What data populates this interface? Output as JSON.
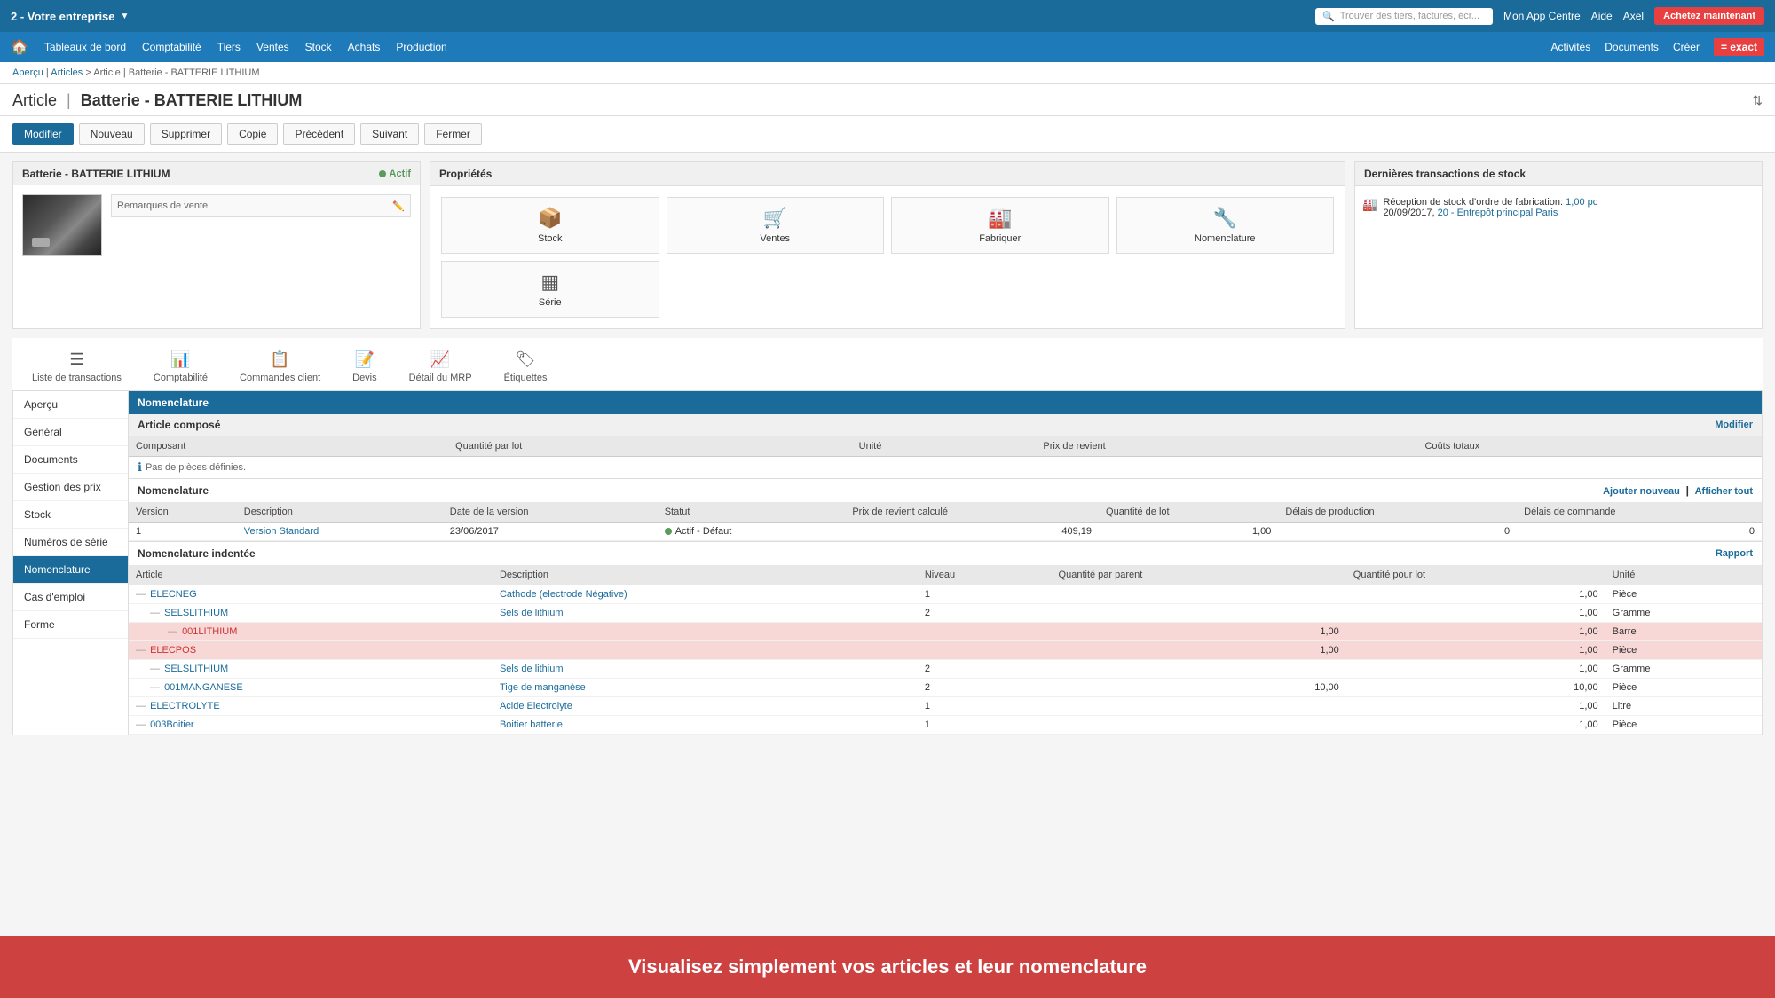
{
  "app": {
    "company": "2 - Votre entreprise",
    "title": "Article | Batterie - BATTERIE LITHIUM",
    "page_title": "Article",
    "article_name": "Batterie - BATTERIE LITHIUM"
  },
  "topbar": {
    "search_placeholder": "Trouver des tiers, factures, écr...",
    "mon_app_centre": "Mon App Centre",
    "aide": "Aide",
    "user": "Axel",
    "achetez": "Achetez maintenant"
  },
  "navbar": {
    "items": [
      {
        "label": "Tableaux de bord"
      },
      {
        "label": "Comptabilité"
      },
      {
        "label": "Tiers"
      },
      {
        "label": "Ventes"
      },
      {
        "label": "Stock"
      },
      {
        "label": "Achats"
      },
      {
        "label": "Production"
      }
    ],
    "right": [
      {
        "label": "Activités"
      },
      {
        "label": "Documents"
      },
      {
        "label": "Créer"
      }
    ]
  },
  "breadcrumb": {
    "items": [
      "Aperçu",
      "Articles",
      "Article | Batterie - BATTERIE LITHIUM"
    ]
  },
  "action_buttons": [
    {
      "label": "Modifier",
      "type": "primary"
    },
    {
      "label": "Nouveau",
      "type": "default"
    },
    {
      "label": "Supprimer",
      "type": "default"
    },
    {
      "label": "Copie",
      "type": "default"
    },
    {
      "label": "Précédent",
      "type": "default"
    },
    {
      "label": "Suivant",
      "type": "default"
    },
    {
      "label": "Fermer",
      "type": "default"
    }
  ],
  "article": {
    "name": "Batterie - BATTERIE LITHIUM",
    "status": "Actif",
    "remarks_label": "Remarques de vente"
  },
  "proprietes": {
    "title": "Propriétés",
    "items": [
      {
        "label": "Stock",
        "icon": "📦"
      },
      {
        "label": "Ventes",
        "icon": "🛒"
      },
      {
        "label": "Fabriquer",
        "icon": "🏭"
      },
      {
        "label": "Nomenclature",
        "icon": "🔧"
      },
      {
        "label": "Série",
        "icon": "▦"
      }
    ]
  },
  "transactions": {
    "title": "Dernières transactions de stock",
    "items": [
      {
        "text": "Réception de stock d'ordre de fabrication:",
        "value": "1,00 pc",
        "date": "20/09/2017,",
        "link": "20 - Entrepôt principal Paris"
      }
    ]
  },
  "tabs": [
    {
      "label": "Liste de transactions",
      "icon": "☰"
    },
    {
      "label": "Comptabilité",
      "icon": "📊"
    },
    {
      "label": "Commandes client",
      "icon": "📋"
    },
    {
      "label": "Devis",
      "icon": "📝"
    },
    {
      "label": "Détail du MRP",
      "icon": "📈"
    },
    {
      "label": "Étiquettes",
      "icon": "🏷"
    }
  ],
  "left_menu": {
    "items": [
      {
        "label": "Aperçu",
        "active": false
      },
      {
        "label": "Général",
        "active": false
      },
      {
        "label": "Documents",
        "active": false
      },
      {
        "label": "Gestion des prix",
        "active": false
      },
      {
        "label": "Stock",
        "active": false
      },
      {
        "label": "Numéros de série",
        "active": false
      },
      {
        "label": "Nomenclature",
        "active": true
      },
      {
        "label": "Cas d'emploi",
        "active": false
      },
      {
        "label": "Forme",
        "active": false
      }
    ]
  },
  "nomenclature": {
    "section_title": "Nomenclature",
    "article_compose": {
      "title": "Article composé",
      "modifier_link": "Modifier",
      "columns": [
        "Composant",
        "Quantité par lot",
        "Unité",
        "Prix de revient",
        "Coûts totaux"
      ],
      "no_pieces": "Pas de pièces définies."
    },
    "table": {
      "title": "Nomenclature",
      "ajouter_link": "Ajouter nouveau",
      "afficher_link": "Afficher tout",
      "columns": [
        "Version",
        "Description",
        "Date de la version",
        "Statut",
        "Prix de revient calculé",
        "Quantité de lot",
        "Délais de production",
        "Délais de commande"
      ],
      "rows": [
        {
          "version": "1",
          "description": "Version Standard",
          "date": "23/06/2017",
          "statut": "Actif - Défaut",
          "prix": "409,19",
          "qte_lot": "1,00",
          "delais_prod": "0",
          "delais_cmd": "0"
        }
      ]
    },
    "indented": {
      "title": "Nomenclature indentée",
      "rapport_link": "Rapport",
      "columns": [
        "Article",
        "Description",
        "Niveau",
        "Quantité par parent",
        "Quantité pour lot",
        "Unité"
      ],
      "rows": [
        {
          "code": "ELECNEG",
          "link": true,
          "description": "Cathode (electrode Négative)",
          "desc_link": true,
          "level": "1",
          "qte_parent": "",
          "qte_lot": "1,00",
          "unit": "Pièce",
          "indent": 0
        },
        {
          "code": "SELSLITHIUM",
          "link": true,
          "description": "Sels de lithium",
          "desc_link": true,
          "level": "2",
          "qte_parent": "",
          "qte_lot": "1,00",
          "unit": "Gramme",
          "indent": 1
        },
        {
          "code": "001LITHIUM",
          "link": true,
          "description": "",
          "desc_link": false,
          "level": "",
          "qte_parent": "1,00",
          "qte_lot": "1,00",
          "unit": "Barre",
          "indent": 2,
          "highlight": true
        },
        {
          "code": "ELECPOS",
          "link": true,
          "description": "",
          "desc_link": false,
          "level": "",
          "qte_parent": "1,00",
          "qte_lot": "1,00",
          "unit": "Pièce",
          "indent": 0,
          "highlight": true
        },
        {
          "code": "SELSLITHIUM",
          "link": true,
          "description": "Sels de lithium",
          "desc_link": true,
          "level": "2",
          "qte_parent": "",
          "qte_lot": "1,00",
          "unit": "Gramme",
          "indent": 1
        },
        {
          "code": "001MANGANESE",
          "link": true,
          "description": "Tige de manganèse",
          "desc_link": true,
          "level": "2",
          "qte_parent": "10,00",
          "qte_lot": "10,00",
          "unit": "Pièce",
          "indent": 1
        },
        {
          "code": "ELECTROLYTE",
          "link": true,
          "description": "Acide Electrolyte",
          "desc_link": true,
          "level": "1",
          "qte_parent": "",
          "qte_lot": "1,00",
          "unit": "Litre",
          "indent": 0
        },
        {
          "code": "003Boitier",
          "link": true,
          "description": "Boitier batterie",
          "desc_link": true,
          "level": "1",
          "qte_parent": "",
          "qte_lot": "1,00",
          "unit": "Pièce",
          "indent": 0
        }
      ]
    }
  },
  "overlay": {
    "text": "Visualisez simplement vos articles et leur nomenclature"
  },
  "colors": {
    "primary": "#1a6b9a",
    "accent": "#e84040",
    "active_bg": "#1a6b9a"
  }
}
